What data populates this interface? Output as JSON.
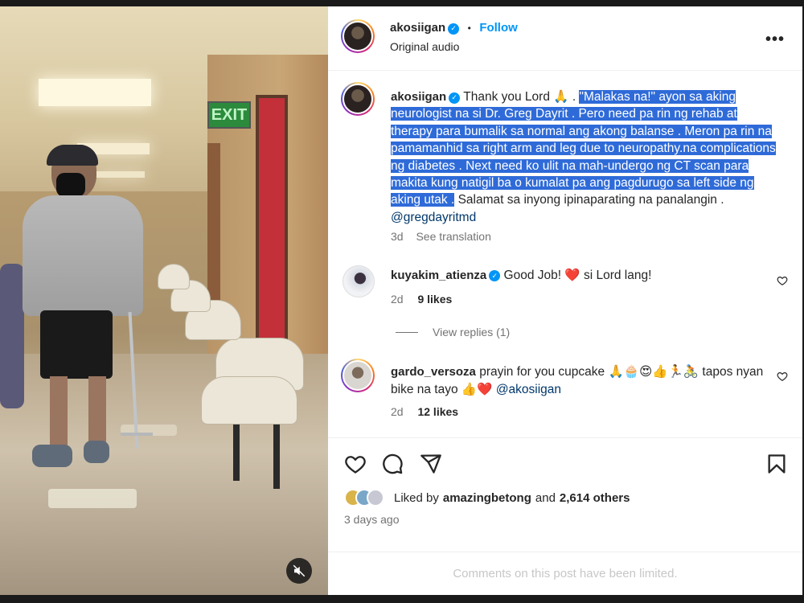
{
  "post": {
    "username": "akosiigan",
    "follow_label": "Follow",
    "separator": "•",
    "audio_label": "Original audio",
    "more_label": "•••"
  },
  "caption": {
    "username": "akosiigan",
    "text_before": "Thank you Lord 🙏 .",
    "highlighted": "\"Malakas na!\" ayon sa aking neurologist na si Dr. Greg Dayrit . Pero need pa rin ng rehab at therapy para bumalik sa normal ang akong balanse . Meron pa rin na pamamanhid sa right arm and leg due to neuropathy.na complications ng diabetes . Next need ko ulit na mah-undergo ng CT scan para makita kung natigil ba o kumalat pa ang pagdurugo sa left side ng aking utak .",
    "text_after": "Salamat sa inyong ipinaparating na panalangin .",
    "mention": "@gregdayritmd",
    "time": "3d",
    "translate": "See translation"
  },
  "comments": [
    {
      "username": "kuyakim_atienza",
      "text": "Good Job! ❤️ si Lord lang!",
      "time": "2d",
      "likes": "9 likes"
    },
    {
      "username": "gardo_versoza",
      "text": "prayin for you cupcake 🙏🧁😍👍🏃🚴 tapos nyan bike na tayo 👍❤️",
      "mention": "@akosiigan",
      "time": "2d",
      "likes": "12 likes"
    }
  ],
  "view_replies": "View replies (1)",
  "liked": {
    "prefix": "Liked by",
    "user": "amazingbetong",
    "and": "and",
    "others": "2,614 others"
  },
  "post_date": "3 days ago",
  "comments_limited": "Comments on this post have been limited.",
  "media": {
    "exit_sign": "EXIT"
  },
  "icons": [
    "verified-icon",
    "more-icon",
    "heart-icon",
    "comment-icon",
    "share-icon",
    "bookmark-icon",
    "mute-icon"
  ],
  "colors": {
    "accent": "#0095f6",
    "highlight": "#2f6bd8",
    "mention": "#00376b",
    "like_red": "#ed4956"
  }
}
